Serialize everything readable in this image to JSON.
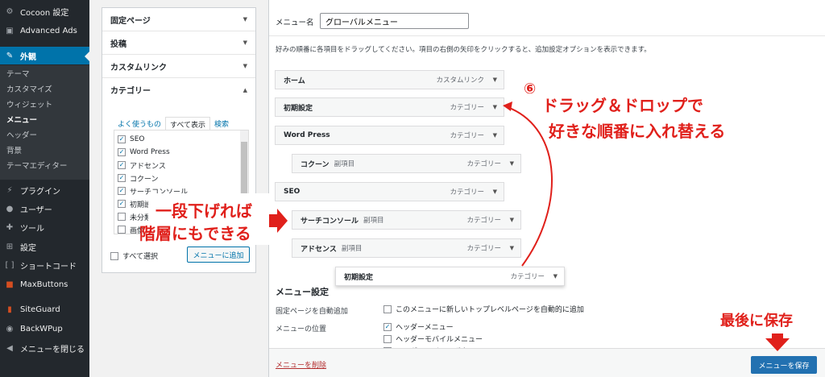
{
  "sidebar": {
    "items": [
      {
        "label": "Cocoon 設定",
        "icon": "gear-icon"
      },
      {
        "label": "Advanced Ads",
        "icon": "ads-icon"
      },
      {
        "label": "外観",
        "icon": "brush-icon"
      },
      {
        "label": "プラグイン",
        "icon": "plug-icon"
      },
      {
        "label": "ユーザー",
        "icon": "user-icon"
      },
      {
        "label": "ツール",
        "icon": "wrench-icon"
      },
      {
        "label": "設定",
        "icon": "settings-icon"
      },
      {
        "label": "ショートコード",
        "icon": "bracket-icon"
      },
      {
        "label": "MaxButtons",
        "icon": "maxbuttons-icon"
      },
      {
        "label": "SiteGuard",
        "icon": "shield-icon"
      },
      {
        "label": "BackWPup",
        "icon": "backup-icon"
      },
      {
        "label": "メニューを閉じる",
        "icon": "collapse-icon"
      }
    ],
    "submenu": [
      "テーマ",
      "カスタマイズ",
      "ウィジェット",
      "メニュー",
      "ヘッダー",
      "背景",
      "テーマエディター"
    ]
  },
  "left_panel": {
    "sections": [
      "固定ページ",
      "投稿",
      "カスタムリンク",
      "カテゴリー"
    ],
    "tabs": [
      "よく使うもの",
      "すべて表示",
      "検索"
    ],
    "categories": [
      {
        "label": "SEO",
        "checked": true
      },
      {
        "label": "Word Press",
        "checked": true
      },
      {
        "label": "アドセンス",
        "checked": true
      },
      {
        "label": "コクーン",
        "checked": true
      },
      {
        "label": "サーチコンソール",
        "checked": true
      },
      {
        "label": "初期設定",
        "checked": true
      },
      {
        "label": "未分類",
        "checked": false
      },
      {
        "label": "画像",
        "checked": false
      }
    ],
    "select_all": "すべて選択",
    "add_button": "メニューに追加"
  },
  "right_panel": {
    "menu_name_label": "メニュー名",
    "menu_name_value": "グローバルメニュー",
    "instructions": "好みの順番に各項目をドラッグしてください。項目の右側の矢印をクリックすると、追加設定オプションを表示できます。",
    "items": [
      {
        "label": "ホーム",
        "sub": "",
        "type": "カスタムリンク"
      },
      {
        "label": "初期設定",
        "sub": "",
        "type": "カテゴリー"
      },
      {
        "label": "Word Press",
        "sub": "",
        "type": "カテゴリー"
      },
      {
        "label": "コクーン",
        "sub": "副項目",
        "type": "カテゴリー"
      },
      {
        "label": "SEO",
        "sub": "",
        "type": "カテゴリー"
      },
      {
        "label": "サーチコンソール",
        "sub": "副項目",
        "type": "カテゴリー"
      },
      {
        "label": "アドセンス",
        "sub": "副項目",
        "type": "カテゴリー"
      },
      {
        "label": "初期設定",
        "sub": "",
        "type": "カテゴリー"
      }
    ],
    "settings_title": "メニュー設定",
    "auto_add_label": "固定ページを自動追加",
    "auto_add_option": "このメニューに新しいトップレベルページを自動的に追加",
    "position_label": "メニューの位置",
    "positions": [
      {
        "label": "ヘッダーメニュー",
        "checked": true
      },
      {
        "label": "ヘッダーモバイルメニュー",
        "checked": false
      },
      {
        "label": "ヘッダーモバイルボタン",
        "checked": false
      }
    ],
    "delete_link": "メニューを削除",
    "save_button": "メニューを保存"
  },
  "annotations": {
    "step_number": "⑥",
    "drag_line1": "ドラッグ＆ドロップで",
    "drag_line2": "好きな順番に入れ替える",
    "indent_line1": "一段下げれば",
    "indent_line2": "階層にもできる",
    "save_note": "最後に保存",
    "color": "#e0201b"
  }
}
